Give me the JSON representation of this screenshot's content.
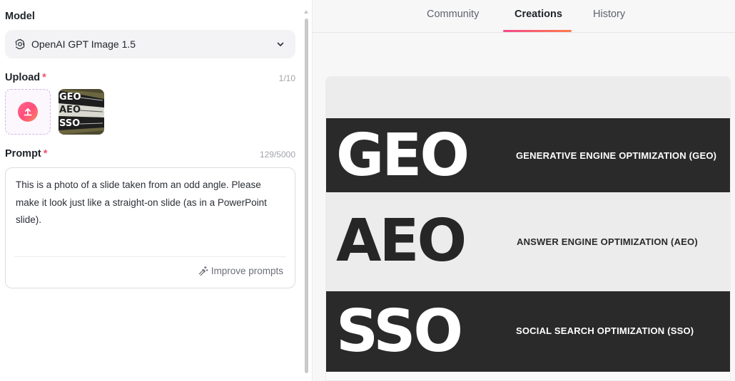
{
  "model": {
    "label": "Model",
    "selected": "OpenAI GPT Image 1.5",
    "icon": "openai-logo-icon"
  },
  "upload": {
    "label": "Upload",
    "required_mark": "*",
    "counter": "1/10",
    "thumbnail_lines": [
      "GEO",
      "AEO",
      "SSO"
    ]
  },
  "prompt": {
    "label": "Prompt",
    "required_mark": "*",
    "counter": "129/5000",
    "value": "This is a photo of a slide taken from an odd angle. Please make it look just like a straight-on slide (as in a PowerPoint slide).",
    "improve_label": "Improve prompts"
  },
  "tabs": [
    {
      "label": "Community",
      "active": false
    },
    {
      "label": "Creations",
      "active": true
    },
    {
      "label": "History",
      "active": false
    }
  ],
  "result": {
    "rows": [
      {
        "acronym": "GEO",
        "caption": "GENERATIVE ENGINE OPTIMIZATION (GEO)",
        "style": "dark"
      },
      {
        "acronym": "AEO",
        "caption": "ANSWER ENGINE OPTIMIZATION (AEO)",
        "style": "light"
      },
      {
        "acronym": "SSO",
        "caption": "SOCIAL SEARCH OPTIMIZATION (SSO)",
        "style": "dark"
      }
    ]
  },
  "colors": {
    "accent_gradient_start": "#f5498c",
    "accent_gradient_end": "#ff7a4a",
    "required": "#f0506e"
  }
}
